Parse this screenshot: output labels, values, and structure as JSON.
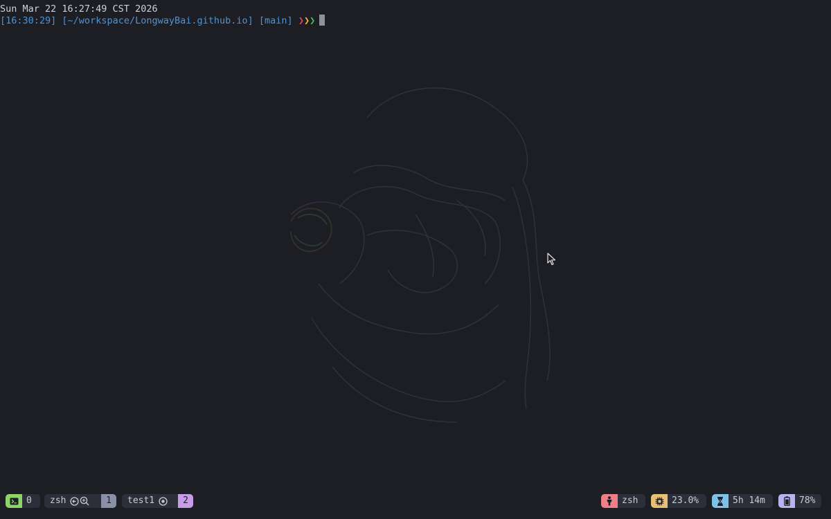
{
  "terminal": {
    "date_line": "Sun Mar 22 16:27:49 CST 2026",
    "prompt": {
      "time": "[16:30:29]",
      "path": "[~/workspace/LongwayBai.github.io]",
      "branch": "[main]",
      "chevrons": [
        "❯",
        "❯",
        "❯"
      ]
    },
    "colors": {
      "background": "#1d1d24",
      "prompt_blue": "#4f94d4",
      "chevron_red": "#e0475b",
      "chevron_yellow": "#e5b93b",
      "chevron_green": "#3fc05a"
    }
  },
  "status_bar": {
    "session": {
      "icon": "terminal-prompt-icon",
      "count": "0",
      "color": "#8fd36b"
    },
    "windows": [
      {
        "name": "zsh",
        "index": "1",
        "icons": [
          "back-circle-icon",
          "zoom-icon"
        ],
        "index_color": "#8a90a8"
      },
      {
        "name": "test1",
        "index": "2",
        "icons": [
          "radio-dot-icon"
        ],
        "index_color": "#c79be8"
      }
    ],
    "right": {
      "process": {
        "icon": "person-icon",
        "value": "zsh",
        "color": "#ef7f86"
      },
      "cpu": {
        "icon": "cpu-chip-icon",
        "value": "23.0%",
        "color": "#e8c073"
      },
      "uptime": {
        "icon": "hourglass-icon",
        "value": "5h 14m",
        "color": "#7dc1e8"
      },
      "battery": {
        "icon": "battery-icon",
        "value": "78%",
        "color": "#b9b3f2"
      }
    }
  }
}
